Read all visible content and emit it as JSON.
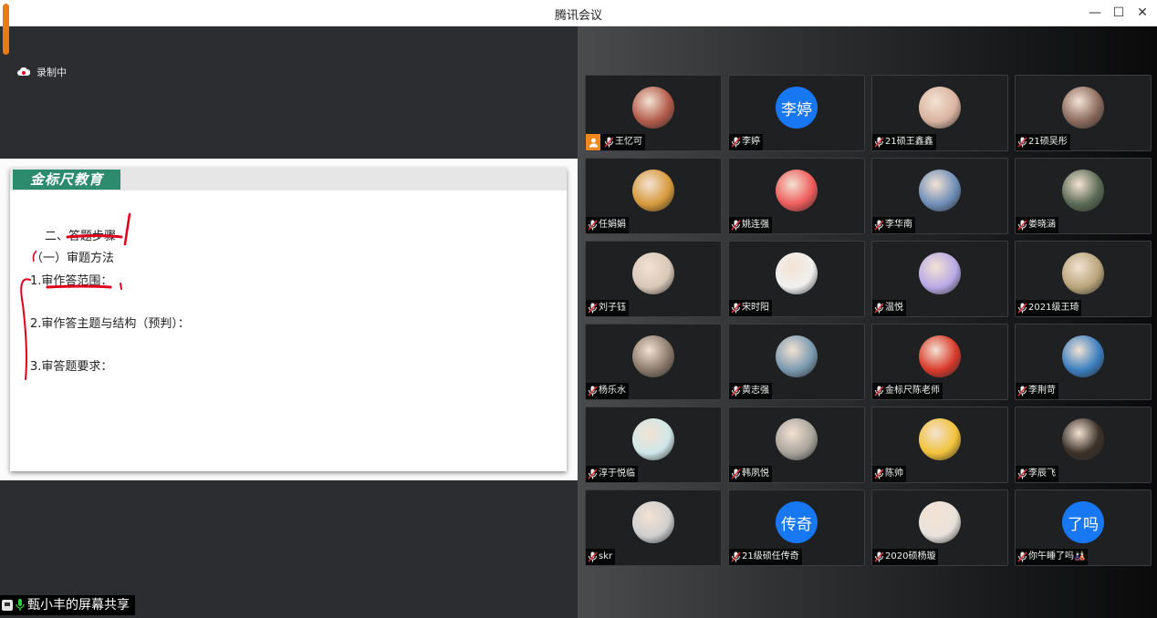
{
  "window": {
    "title": "腾讯会议",
    "minimize_icon": "—",
    "maximize_icon": "☐",
    "close_icon": "✕"
  },
  "recording": {
    "label": "录制中",
    "icon": "cloud-record-icon",
    "color": "#ffffff"
  },
  "shared_slide": {
    "brand": "金标尺教育",
    "brand_color": "#2d8b6d",
    "lines": [
      "二、答题步骤",
      "（一）审题方法",
      "1.审作答范围：",
      "2.审作答主题与结构（预判）：",
      "3.审答题要求："
    ],
    "annotation_color": "#e0001b"
  },
  "share_status": {
    "label": "甄小丰的屏幕共享"
  },
  "participants": [
    {
      "name": "王忆可",
      "avatar_text": "",
      "avatar_color": "#b35b4a",
      "cam_off_badge": true
    },
    {
      "name": "李婷",
      "avatar_text": "李婷",
      "avatar_color": "#1877f2"
    },
    {
      "name": "21硕王鑫鑫",
      "avatar_text": "",
      "avatar_color": "#d9b3a0"
    },
    {
      "name": "21硕吴彤",
      "avatar_text": "",
      "avatar_color": "#8a6a5c"
    },
    {
      "name": "任娟娟",
      "avatar_text": "",
      "avatar_color": "#d79a3b"
    },
    {
      "name": "姚连强",
      "avatar_text": "",
      "avatar_color": "#ef5b5b"
    },
    {
      "name": "李华南",
      "avatar_text": "",
      "avatar_color": "#6f8fb8"
    },
    {
      "name": "娄晓涵",
      "avatar_text": "",
      "avatar_color": "#5a6a55"
    },
    {
      "name": "刘子钰",
      "avatar_text": "",
      "avatar_color": "#d8c8b8"
    },
    {
      "name": "宋时阳",
      "avatar_text": "",
      "avatar_color": "#f0f0f0"
    },
    {
      "name": "温悦",
      "avatar_text": "",
      "avatar_color": "#b8a9e6"
    },
    {
      "name": "2021级王琦",
      "avatar_text": "",
      "avatar_color": "#b9a57a"
    },
    {
      "name": "杨乐水",
      "avatar_text": "",
      "avatar_color": "#8a7a6a"
    },
    {
      "name": "黄志强",
      "avatar_text": "",
      "avatar_color": "#7a9ab0"
    },
    {
      "name": "金标尺陈老师",
      "avatar_text": "",
      "avatar_color": "#d93a2a"
    },
    {
      "name": "李荆苛",
      "avatar_text": "",
      "avatar_color": "#3a7ec0"
    },
    {
      "name": "淳于悦临",
      "avatar_text": "",
      "avatar_color": "#cfe7e8"
    },
    {
      "name": "韩夙悦",
      "avatar_text": "",
      "avatar_color": "#a9a49c"
    },
    {
      "name": "陈帅",
      "avatar_text": "",
      "avatar_color": "#f2c23a"
    },
    {
      "name": "李辰飞",
      "avatar_text": "",
      "avatar_color": "#3a3028"
    },
    {
      "name": "skr",
      "avatar_text": "",
      "avatar_color": "#cfcfcf"
    },
    {
      "name": "21级硕任传奇",
      "avatar_text": "传奇",
      "avatar_color": "#1877f2"
    },
    {
      "name": "2020硕杨璇",
      "avatar_text": "",
      "avatar_color": "#e8e2dc"
    },
    {
      "name": "你午睡了吗🎎",
      "avatar_text": "了吗",
      "avatar_color": "#1877f2"
    }
  ]
}
